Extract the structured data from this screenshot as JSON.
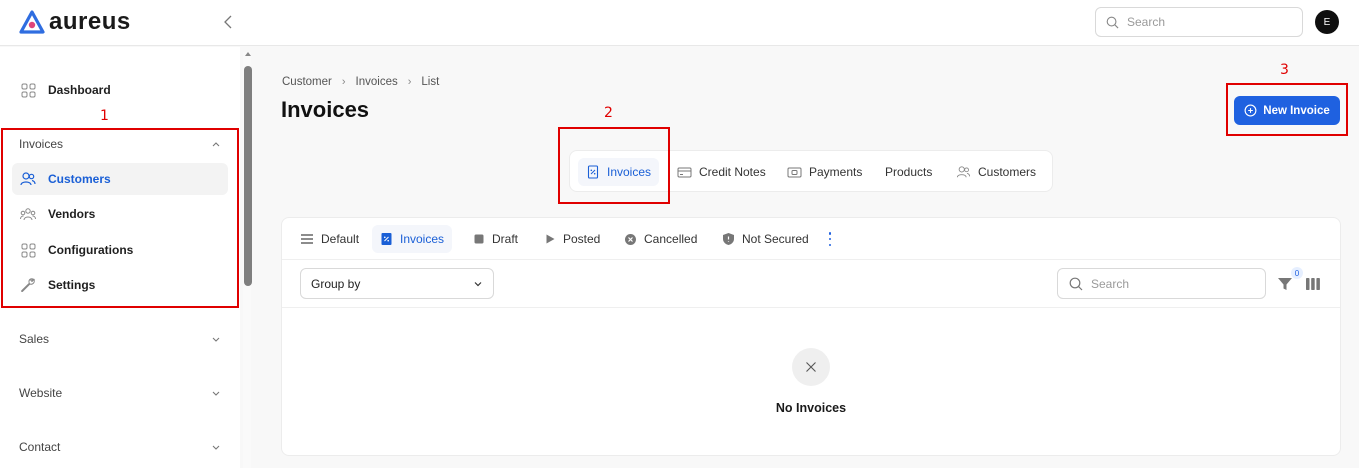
{
  "app": {
    "logo_text": "aureus"
  },
  "header": {
    "search_placeholder": "Search",
    "avatar_initial": "E"
  },
  "sidebar": {
    "dashboard": "Dashboard",
    "invoices_section": "Invoices",
    "items": [
      {
        "label": "Customers",
        "icon": "users-icon",
        "active": true
      },
      {
        "label": "Vendors",
        "icon": "vendors-icon",
        "active": false
      },
      {
        "label": "Configurations",
        "icon": "grid-icon",
        "active": false
      },
      {
        "label": "Settings",
        "icon": "wrench-icon",
        "active": false
      }
    ],
    "sections": [
      "Sales",
      "Website",
      "Contact"
    ]
  },
  "breadcrumb": [
    "Customer",
    "Invoices",
    "List"
  ],
  "page_title": "Invoices",
  "new_invoice_label": "New Invoice",
  "module_tabs": [
    {
      "label": "Invoices",
      "icon": "invoice-icon",
      "active": true
    },
    {
      "label": "Credit Notes",
      "icon": "credit-card-icon",
      "active": false
    },
    {
      "label": "Payments",
      "icon": "payments-icon",
      "active": false
    },
    {
      "label": "Products",
      "icon": "",
      "active": false
    },
    {
      "label": "Customers",
      "icon": "users-icon",
      "active": false
    }
  ],
  "filter_tabs": [
    {
      "label": "Default",
      "icon": "list-icon",
      "active": false
    },
    {
      "label": "Invoices",
      "icon": "invoice-icon",
      "active": true
    },
    {
      "label": "Draft",
      "icon": "square-icon",
      "active": false
    },
    {
      "label": "Posted",
      "icon": "play-icon",
      "active": false
    },
    {
      "label": "Cancelled",
      "icon": "x-circle-icon",
      "active": false
    },
    {
      "label": "Not Secured",
      "icon": "shield-icon",
      "active": false
    }
  ],
  "group_by": {
    "label": "Group by"
  },
  "list_search_placeholder": "Search",
  "filter_count": "0",
  "empty_state": "No Invoices",
  "annotations": [
    "1",
    "2",
    "3"
  ],
  "colors": {
    "accent": "#1f61e0",
    "annotation": "#e00000"
  }
}
